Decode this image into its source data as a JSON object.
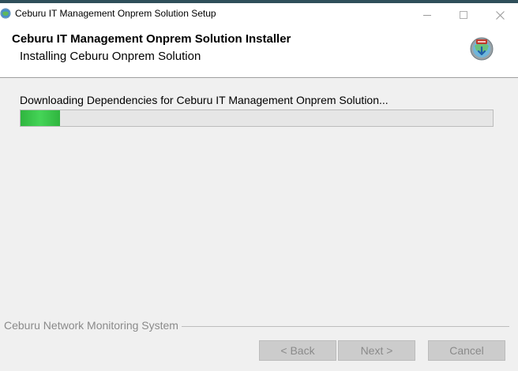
{
  "window": {
    "title": "Ceburu IT Management Onprem Solution Setup",
    "app_icon": "installer-globe-icon",
    "controls": {
      "minimize": "minimize-icon",
      "maximize": "maximize-icon",
      "close": "close-icon"
    }
  },
  "header": {
    "title": "Ceburu IT Management Onprem Solution Installer",
    "subtitle": "Installing Ceburu Onprem Solution",
    "icon": "install-package-icon"
  },
  "main": {
    "status_text": "Downloading Dependencies for Ceburu IT Management Onprem Solution...",
    "progress_fraction": 0.083,
    "progress_color": "#3cc44c"
  },
  "footer": {
    "brand": "Ceburu Network Monitoring System",
    "back_label": "< Back",
    "next_label": "Next >",
    "cancel_label": "Cancel"
  }
}
